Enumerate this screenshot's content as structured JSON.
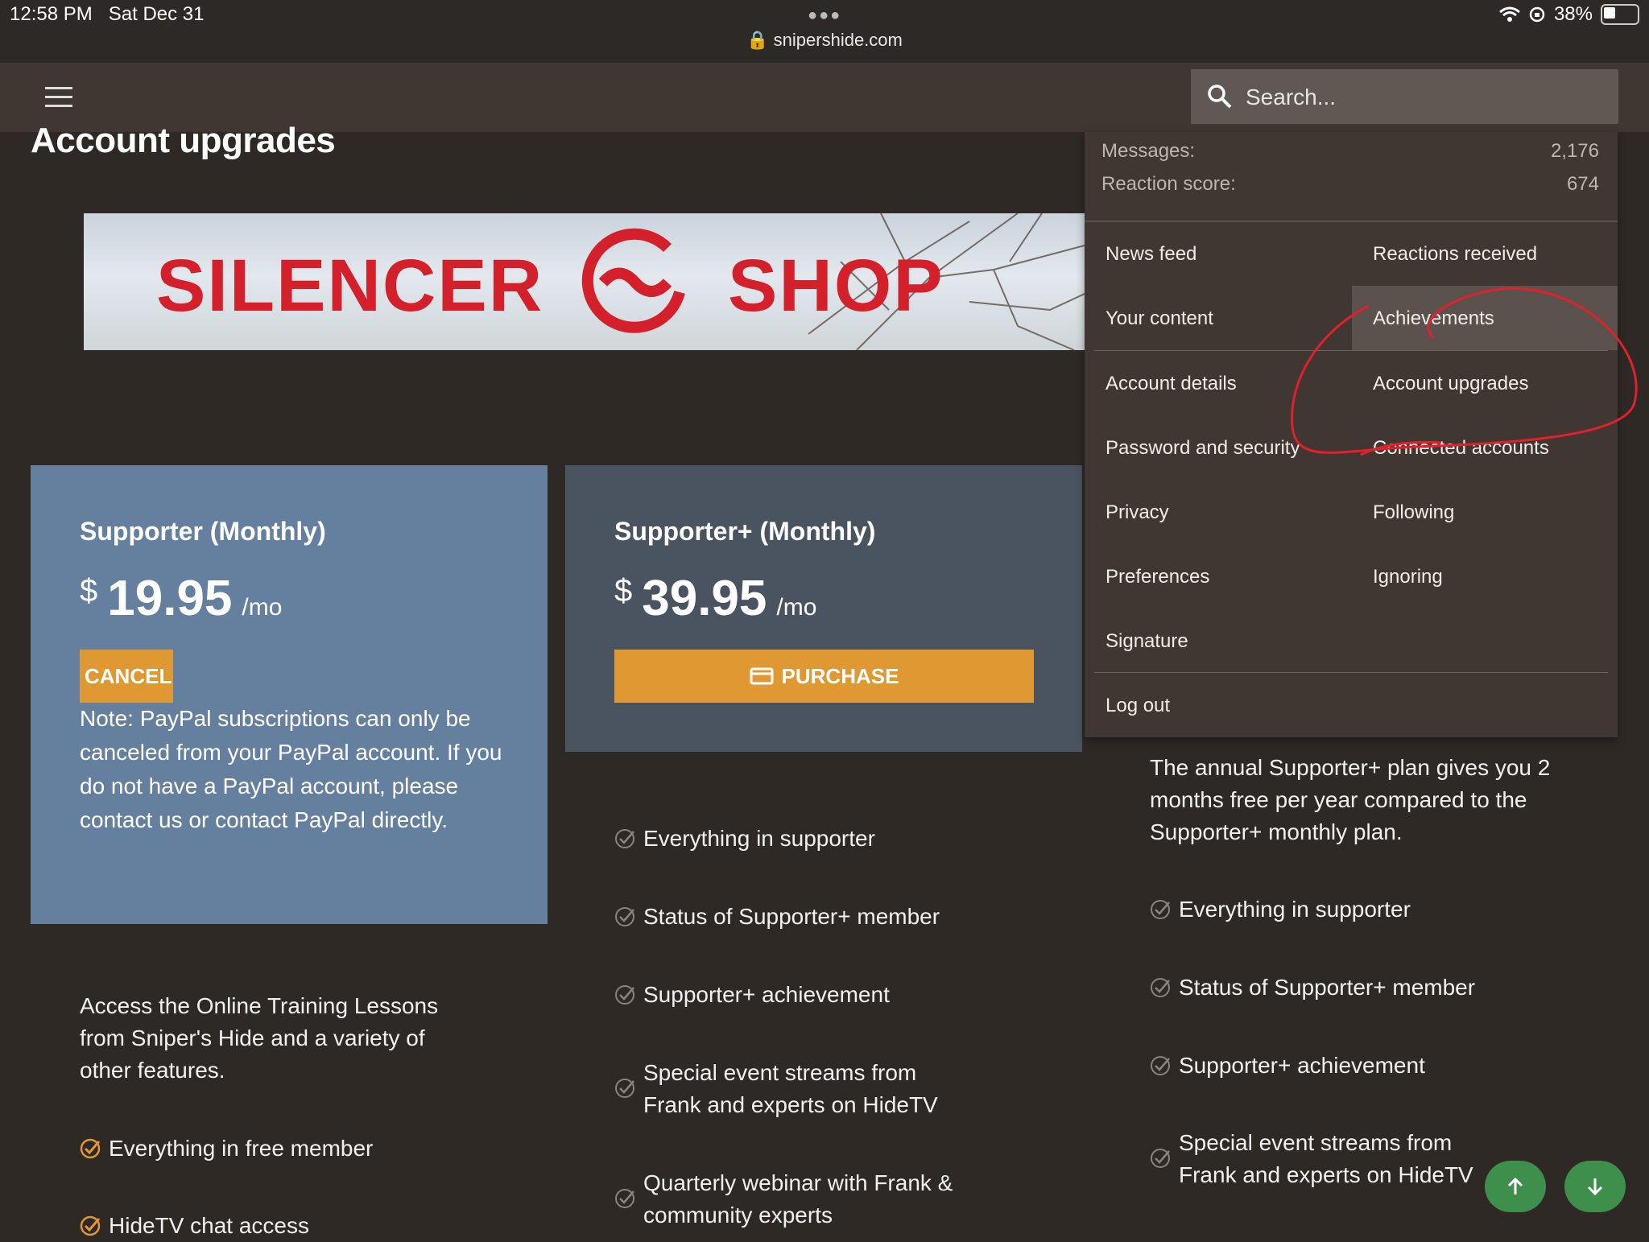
{
  "status_bar": {
    "time": "12:58 PM",
    "date": "Sat Dec 31",
    "url": "snipershide.com",
    "battery": "38%",
    "battery_level": 0.38
  },
  "header": {
    "search_placeholder": "Search..."
  },
  "page": {
    "title": "Account upgrades"
  },
  "banner": {
    "brand_left": "SILENCER",
    "brand_right": "SHOP"
  },
  "cards": [
    {
      "title": "Supporter (Monthly)",
      "currency": "$",
      "amount": "19.95",
      "period": "/mo",
      "button": "CANCEL",
      "note": "Note: PayPal subscriptions can only be canceled from your PayPal account. If you do not have a PayPal account, please contact us or contact PayPal directly.",
      "description": "Access the Online Training Lessons from Sniper's Hide and a variety of other features.",
      "features": [
        "Everything in free member",
        "HideTV chat access"
      ]
    },
    {
      "title": "Supporter+ (Monthly)",
      "currency": "$",
      "amount": "39.95",
      "period": "/mo",
      "button": "PURCHASE",
      "features": [
        "Everything in supporter",
        "Status of Supporter+ member",
        "Supporter+ achievement",
        "Special event streams from Frank and experts on HideTV",
        "Quarterly webinar with Frank & community experts"
      ]
    },
    {
      "description": "The annual Supporter+ plan gives you 2 months free per year compared to the Supporter+ monthly plan.",
      "features": [
        "Everything in supporter",
        "Status of Supporter+ member",
        "Supporter+ achievement",
        "Special event streams from Frank and experts on HideTV"
      ]
    }
  ],
  "account_menu": {
    "stats": [
      {
        "label": "Messages:",
        "value": "2,176"
      },
      {
        "label": "Reaction score:",
        "value": "674"
      }
    ],
    "items_left": [
      "News feed",
      "Your content",
      "Account details",
      "Password and security",
      "Privacy",
      "Preferences",
      "Signature"
    ],
    "items_right": [
      "Reactions received",
      "Achievements",
      "Account upgrades",
      "Connected accounts",
      "Following",
      "Ignoring"
    ],
    "logout": "Log out"
  },
  "colors": {
    "accent": "#df9832",
    "card_supporter": "#65809f",
    "card_supporter_plus": "#4a5360",
    "scroll_button": "#3f8f4c",
    "annotation": "#e0202a"
  }
}
